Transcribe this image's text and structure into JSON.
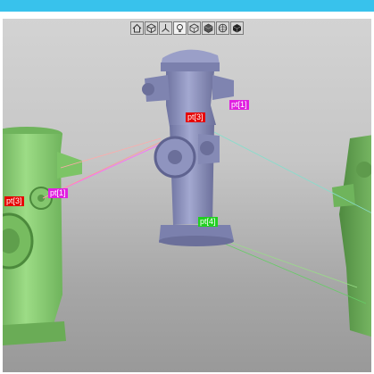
{
  "toolbar": {
    "buttons": [
      {
        "icon": "home-icon"
      },
      {
        "icon": "cube-view-icon"
      },
      {
        "icon": "axes-icon"
      },
      {
        "icon": "light-bulb-icon"
      },
      {
        "icon": "cube-outline-icon"
      },
      {
        "icon": "cube-solid-icon"
      },
      {
        "icon": "sphere-icon"
      },
      {
        "icon": "cube-textured-icon"
      }
    ]
  },
  "colors": {
    "accent_bar": "#38c2ec",
    "left_model": "#8fd07a",
    "center_model": "#8a8fb8",
    "label_red": "#e60000",
    "label_magenta": "#e020e0",
    "label_green": "#20d020"
  },
  "labels": {
    "center_pt3": "pt[3]",
    "center_pt1": "pt[1]",
    "center_pt4": "pt[4]",
    "left_pt1": "pt[1]",
    "left_pt3": "pt[3]"
  }
}
